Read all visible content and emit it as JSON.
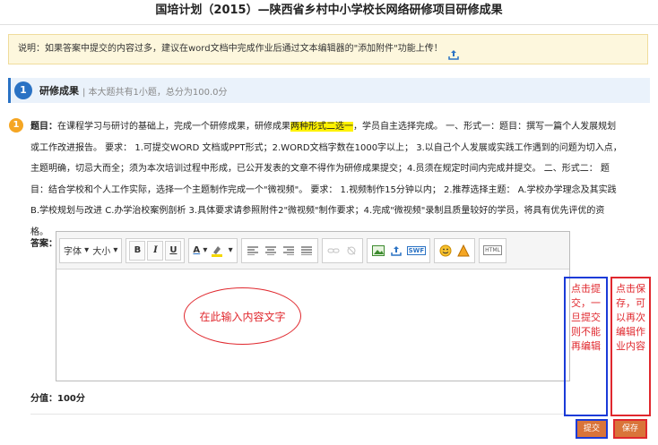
{
  "page": {
    "title": "国培计划（2015）—陕西省乡村中小学校长网络研修项目研修成果"
  },
  "notice": {
    "text": "说明：如果答案中提交的内容过多，建议在word文档中完成作业后通过文本编辑器的\"添加附件\"功能上传！"
  },
  "section": {
    "number": "1",
    "title": "研修成果",
    "meta": "| 本大题共有1小题，总分为100.0分"
  },
  "question": {
    "number": "1",
    "label": "题目：",
    "text_before": "在课程学习与研讨的基础上，完成一个研修成果，研修成果",
    "highlight": "两种形式二选一",
    "text_after": "，学员自主选择完成。 一、形式一：题目：撰写一篇个人发展规划或工作改进报告。 要求： 1.可提交WORD 文档或PPT形式；2.WORD文档字数在1000字以上； 3.以自己个人发展或实践工作遇到的问题为切入点，主题明确，切忌大而全；须为本次培训过程中形成，已公开发表的文章不得作为研修成果提交；4.员须在规定时间内完成并提交。 二、形式二： 题目：结合学校和个人工作实际，选择一个主题制作完成一个\"微视频\"。 要求： 1.视频制作15分钟以内； 2.推荐选择主题： A.学校办学理念及其实践 B.学校规划与改进 C.办学治校案例剖析 3.具体要求请参照附件2\"微视频\"制作要求；4.完成\"微视频\"录制且质量较好的学员，将具有优先评优的资格。"
  },
  "answer": {
    "label": "答案：",
    "placeholder": "在此输入内容文字"
  },
  "toolbar": {
    "font_label": "字体",
    "size_label": "大小",
    "bold": "B",
    "italic": "I",
    "underline": "U",
    "font_color": "A",
    "html": "HTML",
    "swf": "SWF"
  },
  "score": {
    "text": "分值：100分"
  },
  "notes": {
    "submit": "点击提交，一旦提交则不能再编辑",
    "save": "点击保存，可以再次编辑作业内容"
  },
  "buttons": {
    "submit": "提交",
    "save": "保存"
  },
  "colors": {
    "accent_blue": "#2a72c4",
    "annotation_red": "#e0282e",
    "annotation_blue": "#1a3bd8",
    "button_orange": "#d9743a"
  }
}
